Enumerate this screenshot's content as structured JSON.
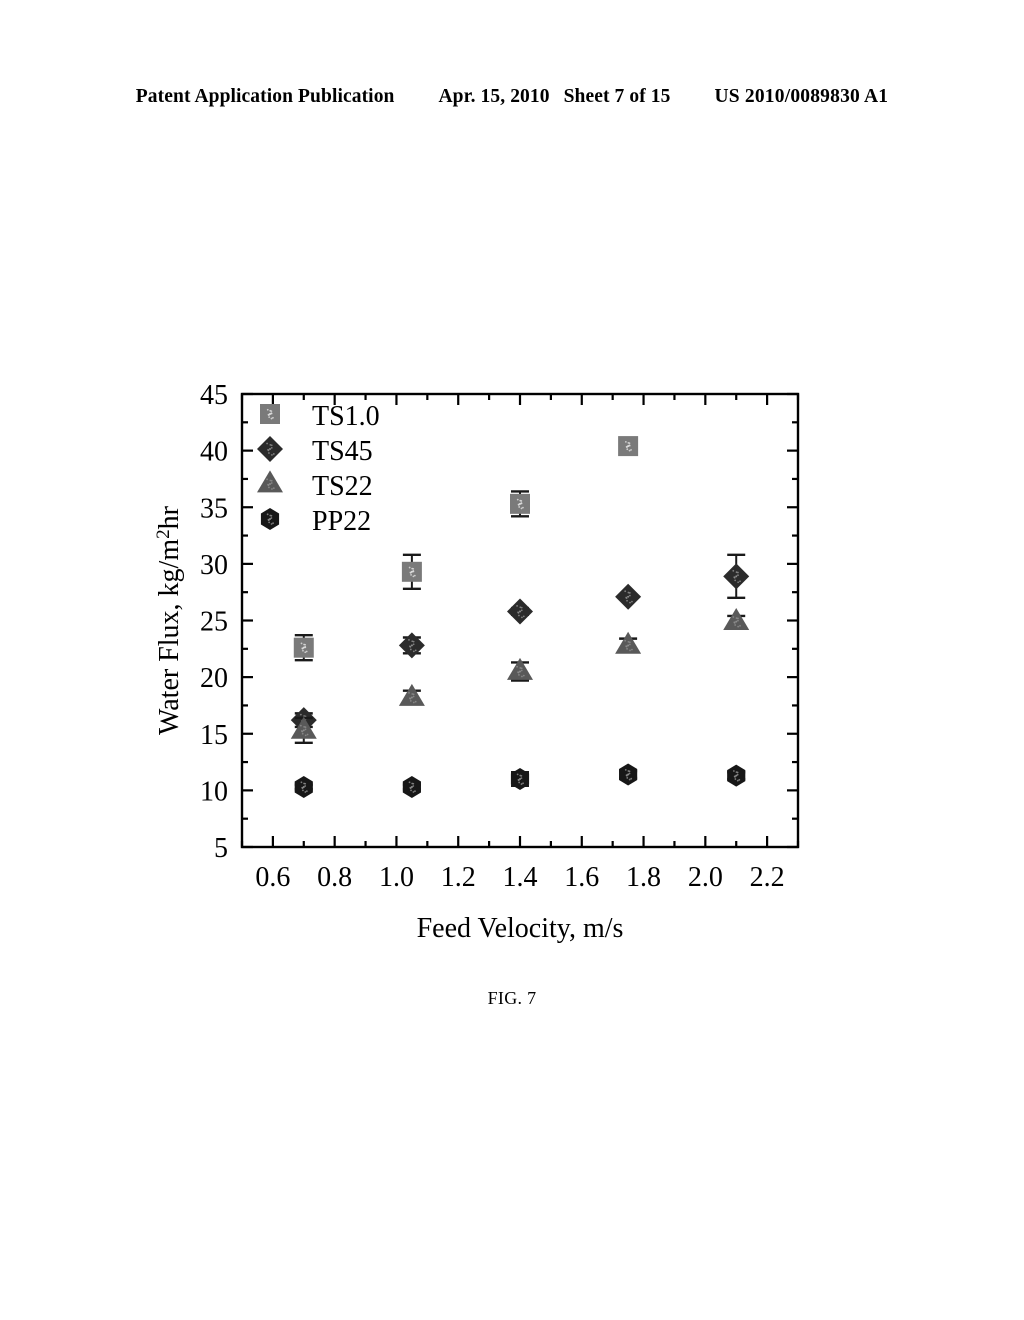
{
  "header": {
    "left": "Patent Application Publication",
    "date": "Apr. 15, 2010",
    "sheet": "Sheet 7 of 15",
    "publication_number": "US 2010/0089830 A1"
  },
  "figure": {
    "caption": "FIG. 7"
  },
  "chart_data": {
    "type": "scatter",
    "title": "",
    "xlabel": "Feed Velocity, m/s",
    "ylabel": "Water Flux, kg/m2hr",
    "ylabel_parts": {
      "prefix": "Water Flux, kg/m",
      "superscript": "2",
      "suffix": "hr"
    },
    "xlim": [
      0.5,
      2.3
    ],
    "ylim": [
      5,
      45
    ],
    "xticks": [
      0.6,
      0.8,
      1.0,
      1.2,
      1.4,
      1.6,
      1.8,
      2.0,
      2.2
    ],
    "xtick_labels": [
      "0.6",
      "0.8",
      "1.0",
      "1.2",
      "1.4",
      "1.6",
      "1.8",
      "2.0",
      "2.2"
    ],
    "yticks": [
      5,
      10,
      15,
      20,
      25,
      30,
      35,
      40,
      45
    ],
    "ytick_labels": [
      "5",
      "10",
      "15",
      "20",
      "25",
      "30",
      "35",
      "40",
      "45"
    ],
    "x_minor_step": 0.1,
    "y_minor_step": 2.5,
    "grid": false,
    "legend_position": "top-left",
    "error_bars": true,
    "series": [
      {
        "name": "TS1.0",
        "marker": "square",
        "color": "#7a7a7a",
        "x": [
          0.7,
          1.05,
          1.4,
          1.75
        ],
        "values": [
          22.6,
          29.3,
          35.3,
          40.4
        ],
        "errors": [
          1.1,
          1.5,
          1.1,
          0.5
        ]
      },
      {
        "name": "TS45",
        "marker": "diamond",
        "color": "#2b2b2b",
        "x": [
          0.7,
          1.05,
          1.4,
          1.75,
          2.1
        ],
        "values": [
          16.2,
          22.8,
          25.8,
          27.1,
          28.9
        ],
        "errors": [
          0.6,
          0.7,
          0.3,
          0.2,
          1.9
        ]
      },
      {
        "name": "TS22",
        "marker": "triangle",
        "color": "#595959",
        "x": [
          0.7,
          1.05,
          1.4,
          1.75,
          2.1
        ],
        "values": [
          15.3,
          18.2,
          20.5,
          22.8,
          24.9
        ],
        "errors": [
          1.1,
          0.6,
          0.8,
          0.6,
          0.5
        ]
      },
      {
        "name": "PP22",
        "marker": "hexagon",
        "color": "#171717",
        "x": [
          0.7,
          1.05,
          1.4,
          1.75,
          2.1
        ],
        "values": [
          10.3,
          10.3,
          11.0,
          11.4,
          11.3
        ],
        "errors": [
          0.2,
          0.2,
          0.6,
          0.3,
          0.3
        ]
      }
    ]
  }
}
